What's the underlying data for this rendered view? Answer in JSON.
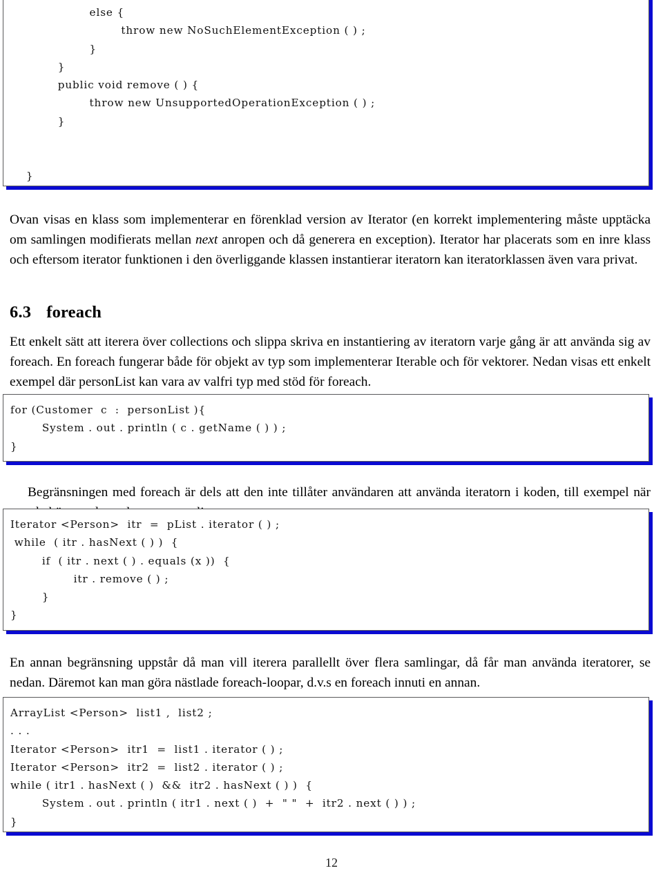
{
  "document": {
    "page_number": "12",
    "accent_shadow_color": "#0a0ad2",
    "listing_border_color": "#58585a"
  },
  "code_blocks": {
    "iterator_tail": "                    else {\n                            throw new NoSuchElementException ( ) ;\n                    }\n            }\n            public void remove ( ) {\n                    throw new UnsupportedOperationException ( ) ;\n            }\n\n\n    }\n}",
    "foreach_example": "for (Customer  c  :  personList ){\n        System . out . println ( c . getName ( ) ) ;\n}",
    "iterator_remove": "Iterator <Person>  itr  =  pList . iterator ( ) ;\n while  ( itr . hasNext ( ) )  {\n        if  ( itr . next ( ) . equals (x ))  {\n                itr . remove ( ) ;\n        }\n}",
    "parallel_iterators": "ArrayList <Person>  list1 ,  list2 ;\n. . .\nIterator <Person>  itr1  =  list1 . iterator ( ) ;\nIterator <Person>  itr2  =  list2 . iterator ( ) ;\nwhile ( itr1 . hasNext ( )  &&  itr2 . hasNext ( ) )  {\n        System . out . println ( itr1 . next ( )  +  \" \"  +  itr2 . next ( ) ) ;\n}"
  },
  "paragraphs": {
    "iterator_notes_part1": "Ovan visas en klass som implementerar en förenklad version av Iterator (en korrekt implementering måste upptäcka om samlingen modifierats mellan ",
    "iterator_notes_emphasis": "next",
    "iterator_notes_part2": " anropen och då generera en exception). Iterator har placerats som en inre klass och eftersom iterator funktionen i den överliggande klassen instantierar iteratorn kan iteratorklassen även vara privat.",
    "foreach_intro": "Ett enkelt sätt att iterera över collections och slippa skriva en instantiering av iteratorn varje gång är att använda sig av foreach. En foreach fungerar både för objekt av typ som implementerar Iterable och för vektorer. Nedan visas ett enkelt exempel där personList kan vara av valfri typ med stöd för foreach.",
    "foreach_limits": "Begränsningen med foreach är dels att den inte tillåter användaren att använda iteratorn i koden, till exempel när man behöver ta bort element ur en lista:",
    "parallel_note": "En annan begränsning uppstår då man vill iterera parallellt över flera samlingar, då får man använda iteratorer, se nedan. Däremot kan man göra nästlade foreach-loopar, d.v.s en foreach innuti en annan."
  },
  "section": {
    "number": "6.3",
    "title": "foreach"
  }
}
